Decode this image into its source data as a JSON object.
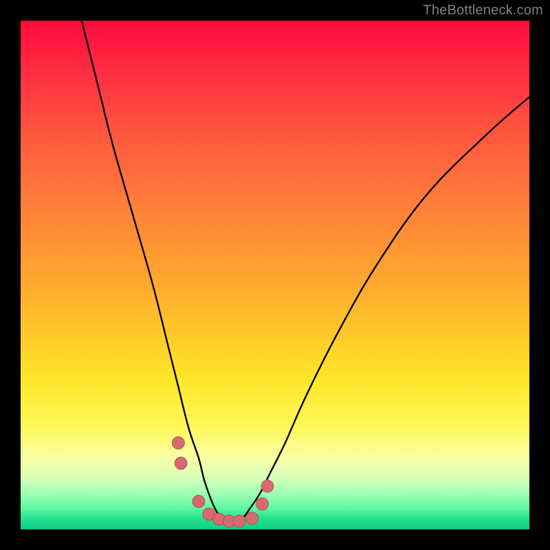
{
  "watermark": "TheBottleneck.com",
  "chart_data": {
    "type": "line",
    "title": "",
    "xlabel": "",
    "ylabel": "",
    "xlim": [
      0,
      100
    ],
    "ylim": [
      0,
      100
    ],
    "series": [
      {
        "name": "curve",
        "x": [
          12,
          15,
          18,
          22,
          26,
          29,
          31,
          33,
          35,
          36,
          37,
          38,
          39,
          40,
          41,
          42,
          43,
          44,
          45,
          47,
          49,
          52,
          56,
          62,
          70,
          80,
          92,
          100
        ],
        "values": [
          100,
          88,
          76,
          62,
          48,
          36,
          28,
          20,
          14,
          10,
          7,
          4.5,
          2.8,
          1.8,
          1.4,
          1.4,
          1.8,
          2.6,
          4,
          7,
          11,
          17,
          26,
          38,
          52,
          66,
          78,
          85
        ]
      }
    ],
    "markers": {
      "name": "highlighted-points",
      "x": [
        31.0,
        31.5,
        35.0,
        37.0,
        39.0,
        41.0,
        43.0,
        45.5,
        47.5,
        48.5
      ],
      "values": [
        17.0,
        13.0,
        5.5,
        3.0,
        2.0,
        1.6,
        1.6,
        2.2,
        5.0,
        8.5
      ]
    },
    "background_gradient": [
      "#ff0b3a",
      "#ff7e3a",
      "#ffe427",
      "#f7ffa6",
      "#22e08c"
    ]
  }
}
